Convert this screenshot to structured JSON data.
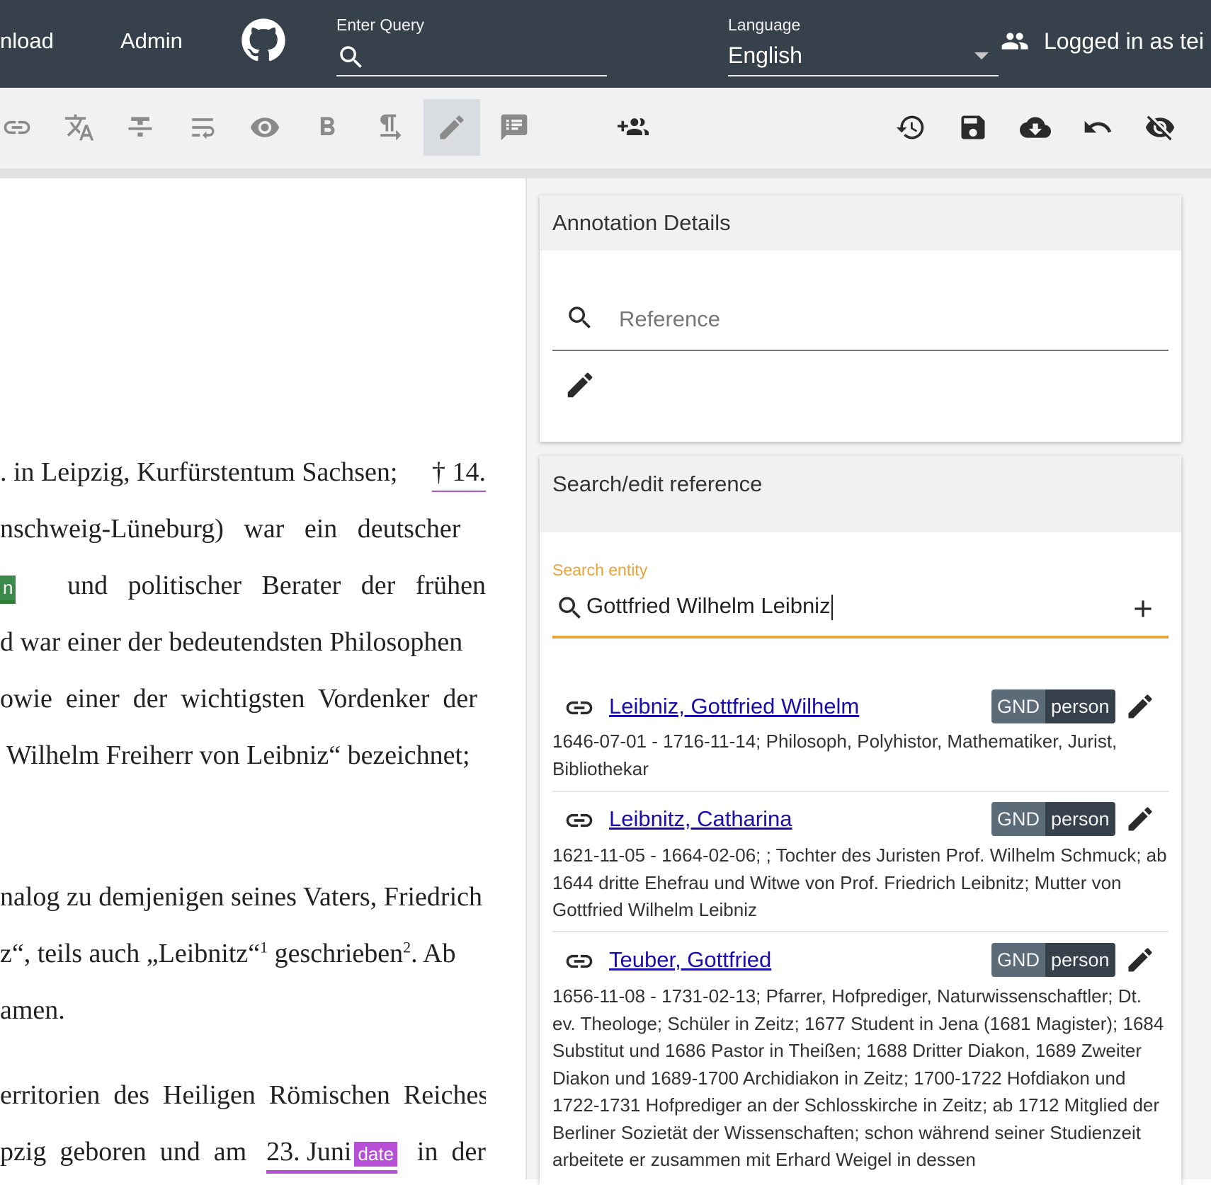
{
  "topbar": {
    "nav_download": "nload",
    "nav_admin": "Admin",
    "query_label": "Enter Query",
    "language_label": "Language",
    "language_value": "English",
    "user_text": "Logged in as tei"
  },
  "toolbar": {
    "icons": [
      "link-icon",
      "translate-icon",
      "strikethrough-icon",
      "wrap-text-icon",
      "eye-icon",
      "bold-icon",
      "paragraph-icon",
      "pencil-icon",
      "comment-list-icon",
      "add-person-icon",
      "history-icon",
      "save-icon",
      "cloud-download-icon",
      "undo-icon",
      "hide-icon"
    ],
    "active": "pencil-icon"
  },
  "document": {
    "l1": ". in Leipzig, Kurfürstentum Sachsen;",
    "l1_date": "† 14.",
    "l2": "nschweig-Lüneburg)   war   ein   deutscher",
    "l3_tag": "n",
    "l3": "und   politischer   Berater   der   frühen",
    "l4": "d war einer der bedeutendsten Philosophen",
    "l5": "owie  einer  der  wichtigsten  Vordenker  der",
    "l6": " Wilhelm Freiherr von Leibniz“ bezeichnet;",
    "l7": "nalog zu demjenigen seines Vaters, Friedrich",
    "l8a": "z“, teils auch „Leibnitz“",
    "l8_sup1": "1",
    "l8b": " geschrieben",
    "l8_sup2": "2",
    "l8c": ". Ab",
    "l9": "amen.",
    "l10": "erritorien  des  Heiligen  Römischen  Reiches",
    "l11a": "pzig  geboren  und  am",
    "l11_date": "23. Juni",
    "l11_tag": "date",
    "l11b": "in  der"
  },
  "annotation": {
    "title": "Annotation Details",
    "reference_placeholder": "Reference"
  },
  "search": {
    "title": "Search/edit reference",
    "label": "Search entity",
    "value": "Gottfried Wilhelm Leibniz",
    "results": [
      {
        "title": "Leibniz, Gottfried Wilhelm",
        "source": "GND",
        "type": "person",
        "desc": "1646-07-01 - 1716-11-14; Philosoph, Polyhistor, Mathematiker, Jurist, Bibliothekar"
      },
      {
        "title": "Leibnitz, Catharina",
        "source": "GND",
        "type": "person",
        "desc": "1621-11-05 - 1664-02-06; ; Tochter des Juristen Prof. Wilhelm Schmuck; ab 1644 dritte Ehefrau und Witwe von Prof. Friedrich Leibnitz; Mutter von Gottfried Wilhelm Leibniz"
      },
      {
        "title": "Teuber, Gottfried",
        "source": "GND",
        "type": "person",
        "desc": "1656-11-08 - 1731-02-13; Pfarrer, Hofprediger, Naturwissenschaftler; Dt. ev. Theologe; Schüler in Zeitz; 1677 Student in Jena (1681 Magister); 1684 Substitut und 1686 Pastor in Theißen; 1688 Dritter Diakon, 1689 Zweiter Diakon und 1689-1700 Archidiakon in Zeitz; 1700-1722 Hofdiakon und 1722-1731 Hofprediger an der Schlosskirche in Zeitz; ab 1712 Mitglied der Berliner Sozietät der Wissenschaften; schon während seiner Studienzeit arbeitete er zusammen mit Erhard Weigel in dessen"
      }
    ]
  }
}
